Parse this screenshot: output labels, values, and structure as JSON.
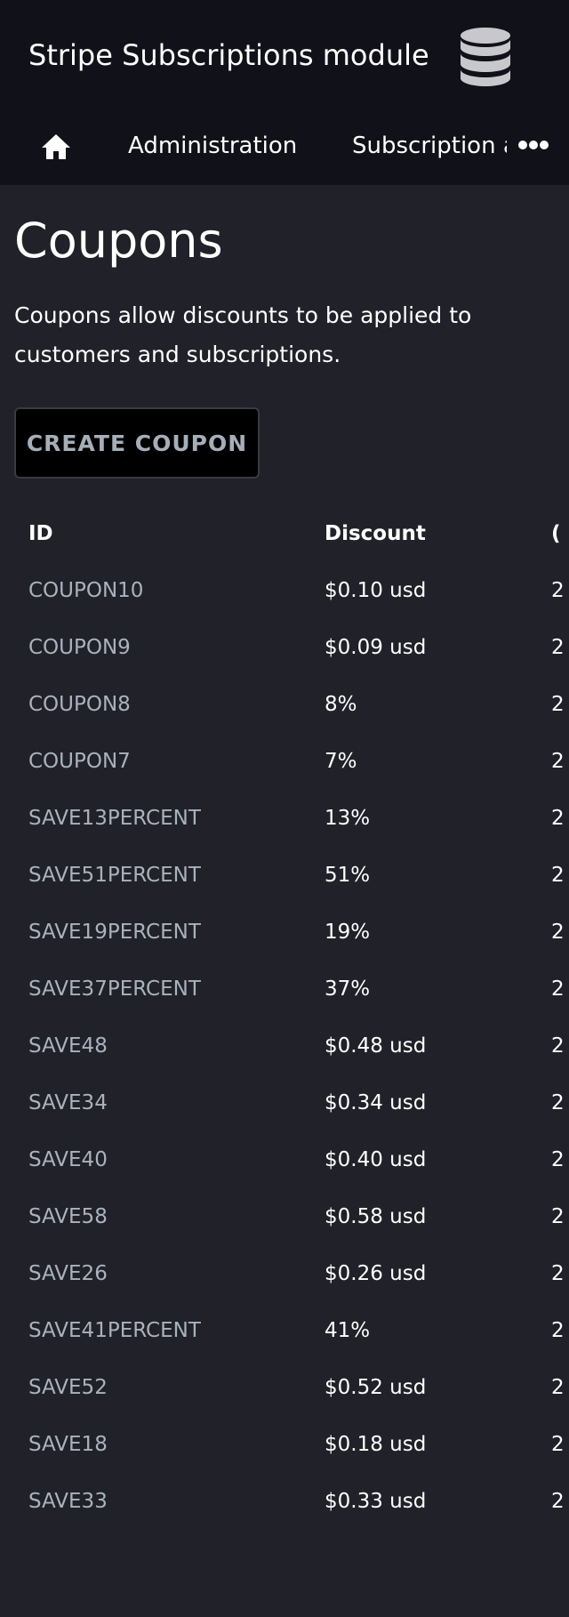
{
  "header": {
    "title": "Stripe Subscriptions module",
    "db_icon": "database-icon",
    "home_icon": "home-icon",
    "more_icon": "more-horizontal-icon",
    "nav": {
      "administration": "Administration",
      "subscription": "Subscription a"
    }
  },
  "main": {
    "title": "Coupons",
    "description": "Coupons allow discounts to be applied to customers and subscriptions.",
    "create_button": "CREATE COUPON"
  },
  "table": {
    "columns": [
      "ID",
      "Discount",
      "("
    ],
    "rows": [
      {
        "id": "COUPON10",
        "discount": "$0.10 usd",
        "third": "2"
      },
      {
        "id": "COUPON9",
        "discount": "$0.09 usd",
        "third": "2"
      },
      {
        "id": "COUPON8",
        "discount": "8%",
        "third": "2"
      },
      {
        "id": "COUPON7",
        "discount": "7%",
        "third": "2"
      },
      {
        "id": "SAVE13PERCENT",
        "discount": "13%",
        "third": "2"
      },
      {
        "id": "SAVE51PERCENT",
        "discount": "51%",
        "third": "2"
      },
      {
        "id": "SAVE19PERCENT",
        "discount": "19%",
        "third": "2"
      },
      {
        "id": "SAVE37PERCENT",
        "discount": "37%",
        "third": "2"
      },
      {
        "id": "SAVE48",
        "discount": "$0.48 usd",
        "third": "2"
      },
      {
        "id": "SAVE34",
        "discount": "$0.34 usd",
        "third": "2"
      },
      {
        "id": "SAVE40",
        "discount": "$0.40 usd",
        "third": "2"
      },
      {
        "id": "SAVE58",
        "discount": "$0.58 usd",
        "third": "2"
      },
      {
        "id": "SAVE26",
        "discount": "$0.26 usd",
        "third": "2"
      },
      {
        "id": "SAVE41PERCENT",
        "discount": "41%",
        "third": "2"
      },
      {
        "id": "SAVE52",
        "discount": "$0.52 usd",
        "third": "2"
      },
      {
        "id": "SAVE18",
        "discount": "$0.18 usd",
        "third": "2"
      },
      {
        "id": "SAVE33",
        "discount": "$0.33 usd",
        "third": "2"
      }
    ]
  },
  "colors": {
    "page_bg": "#212129",
    "header_bg": "#111119",
    "link": "#a9b2bd",
    "button_bg": "#000000",
    "button_text": "#a5aeb9",
    "icon": "#c8c8cc"
  }
}
